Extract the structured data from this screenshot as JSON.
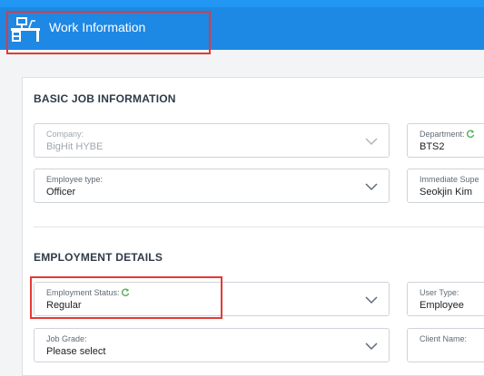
{
  "header": {
    "title": "Work Information",
    "icon": "desk-icon",
    "color": "#1e88e5"
  },
  "sections": {
    "basic": {
      "title": "BASIC JOB INFORMATION",
      "company": {
        "label": "Company:",
        "value": "BigHit HYBE",
        "disabled": true
      },
      "department": {
        "label": "Department:",
        "value": "BTS2"
      },
      "employee_type": {
        "label": "Employee type:",
        "value": "Officer"
      },
      "immediate_superior": {
        "label": "Immediate Supe",
        "value": "Seokjin Kim"
      }
    },
    "employment": {
      "title": "EMPLOYMENT DETAILS",
      "employment_status": {
        "label": "Employment Status:",
        "value": "Regular"
      },
      "user_type": {
        "label": "User Type:",
        "value": "Employee"
      },
      "job_grade": {
        "label": "Job Grade:",
        "value": "Please select"
      },
      "client_name": {
        "label": "Client Name:",
        "value": ""
      }
    }
  },
  "colors": {
    "accent": "#1e88e5",
    "highlight": "#e53935",
    "sync_icon": "#4caf50"
  }
}
